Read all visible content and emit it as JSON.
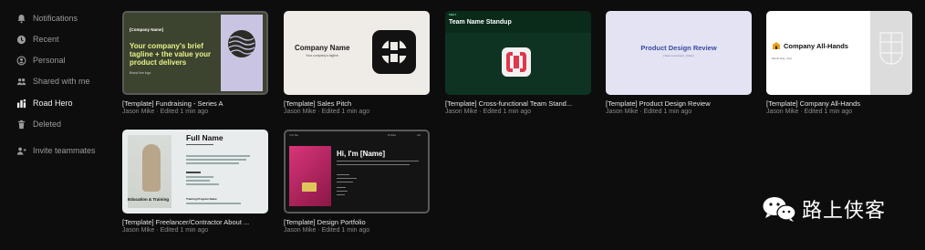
{
  "sidebar": {
    "items": [
      {
        "label": "Notifications",
        "icon": "bell-icon"
      },
      {
        "label": "Recent",
        "icon": "clock-icon"
      },
      {
        "label": "Personal",
        "icon": "user-circle-icon"
      },
      {
        "label": "Shared with me",
        "icon": "people-icon"
      },
      {
        "label": "Road Hero",
        "icon": "team-icon",
        "active": true
      },
      {
        "label": "Deleted",
        "icon": "trash-icon"
      },
      {
        "label": "Invite teammates",
        "icon": "add-user-icon"
      }
    ]
  },
  "cards": [
    {
      "title": "[Template] Fundraising - Series A",
      "subtitle": "Jason Mike · Edited 1 min ago",
      "thumb": {
        "small": "[Company Name]",
        "big": "Your company's brief tagline + the value your product delivers",
        "foot": "Brand line logo"
      }
    },
    {
      "title": "[Template] Sales Pitch",
      "subtitle": "Jason Mike · Edited 1 min ago",
      "thumb": {
        "name": "Company Name",
        "tag": "Your company's tagline"
      }
    },
    {
      "title": "[Template] Cross-functional Team Stand...",
      "subtitle": "Jason Mike · Edited 1 min ago",
      "thumb": {
        "tiny": "MEET",
        "head": "Team Name Standup"
      }
    },
    {
      "title": "[Template] Product Design Review",
      "subtitle": "Jason Mike · Edited 1 min ago",
      "thumb": {
        "head": "Product Design Review",
        "sub": "[Team members] · [Date]"
      }
    },
    {
      "title": "[Template] Company All-Hands",
      "subtitle": "Jason Mike · Edited 1 min ago",
      "thumb": {
        "head": "Company All-Hands",
        "sub": "Month Day, Year"
      }
    },
    {
      "title": "[Template] Freelancer/Contractor About ...",
      "subtitle": "Jason Mike · Edited 1 min ago",
      "thumb": {
        "name": "Full Name",
        "edu": "Education & Training",
        "tp": "Training Program Name"
      }
    },
    {
      "title": "[Template] Design Portfolio",
      "subtitle": "Jason Mike · Edited 1 min ago",
      "thumb": {
        "nav_left": "Your Site",
        "nav_mid": "Portfolio",
        "nav_right": "Info",
        "hi": "Hi, I'm [Name]"
      }
    }
  ],
  "watermark": {
    "text": "路上侠客",
    "icon": "wechat-icon"
  },
  "colors": {
    "background": "#0d0d0d",
    "accent_text": "#e8f28a"
  }
}
